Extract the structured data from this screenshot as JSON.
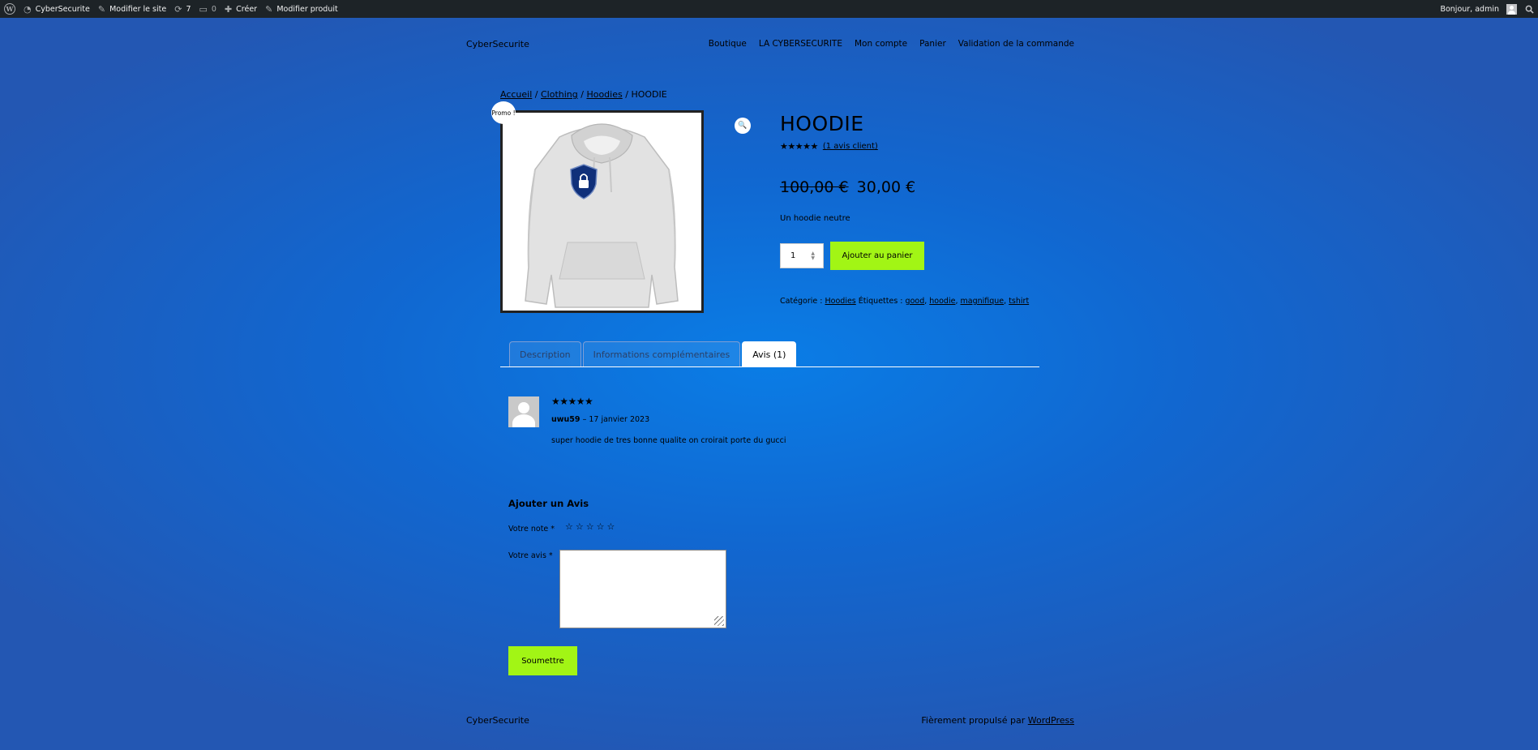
{
  "adminbar": {
    "site_name": "CyberSecurite",
    "customize": "Modifier le site",
    "updates_count": "7",
    "comments_count": "0",
    "new": "Créer",
    "edit_product": "Modifier produit",
    "greeting": "Bonjour, admin"
  },
  "header": {
    "site_title": "CyberSecurite",
    "nav": [
      "Boutique",
      "LA CYBERSECURITE",
      "Mon compte",
      "Panier",
      "Validation de la commande"
    ]
  },
  "breadcrumb": {
    "items": [
      "Accueil",
      "Clothing",
      "Hoodies"
    ],
    "current": "HOODIE",
    "separator": " / "
  },
  "product": {
    "badge": "Promo !",
    "title": "HOODIE",
    "rating_stars": "★★★★★",
    "review_link": "(1 avis client)",
    "old_price": "100,00 €",
    "price": "30,00 €",
    "short_description": "Un hoodie neutre",
    "quantity": "1",
    "add_to_cart": "Ajouter au panier",
    "category_label": "Catégorie :",
    "category": "Hoodies",
    "tags_label": "Étiquettes :",
    "tags": [
      "good",
      "hoodie",
      "magnifique",
      "tshirt"
    ]
  },
  "tabs": [
    "Description",
    "Informations complémentaires",
    "Avis (1)"
  ],
  "review": {
    "stars": "★★★★★",
    "author": "uwu59",
    "date": "– 17 janvier 2023",
    "text": "super hoodie de tres bonne qualite on croirait porte du gucci"
  },
  "review_form": {
    "title": "Ajouter un Avis",
    "rating_label": "Votre note *",
    "rating_options": [
      "☆",
      "☆",
      "☆",
      "☆",
      "☆"
    ],
    "comment_label": "Votre avis *",
    "submit": "Soumettre"
  },
  "footer": {
    "site_title": "CyberSecurite",
    "credit_prefix": "Fièrement propulsé par ",
    "credit_link": "WordPress"
  },
  "colors": {
    "accent_button": "#a2f515",
    "background": "#0a7de6",
    "adminbar": "#1d2327"
  }
}
